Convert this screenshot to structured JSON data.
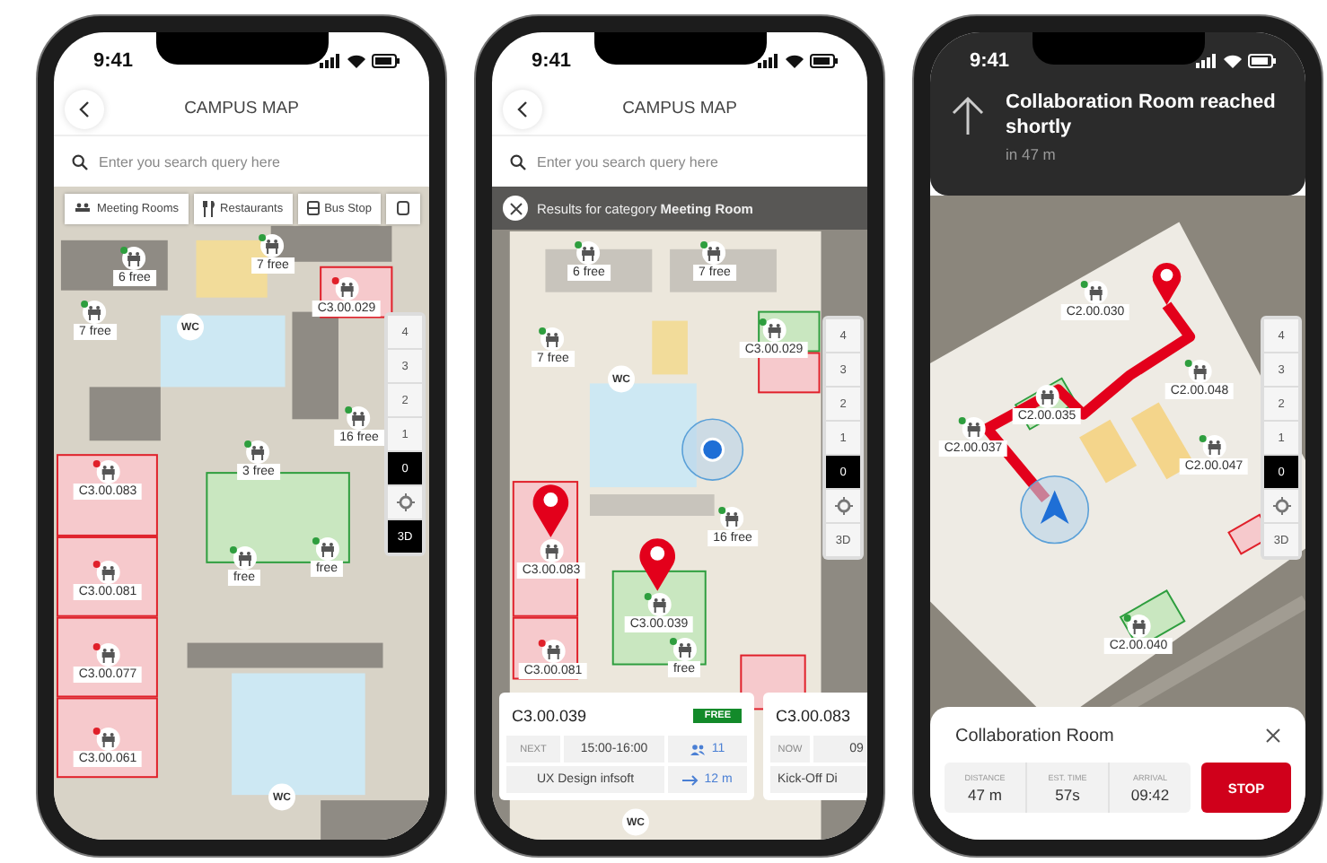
{
  "phones": [
    {
      "kind": "search",
      "status_time": "9:41",
      "title": "CAMPUS MAP",
      "search": {
        "placeholder": "Enter you search query here"
      },
      "chips": [
        {
          "label": "Meeting Rooms"
        },
        {
          "label": "Restaurants"
        },
        {
          "label": "Bus Stop"
        }
      ],
      "map_labels": [
        {
          "kind": "room",
          "text": "6 free",
          "color": "#2e9e3e"
        },
        {
          "kind": "room",
          "text": "7 free",
          "color": "#2e9e3e"
        },
        {
          "kind": "room",
          "text": "C3.00.029",
          "color": "#e0202a"
        },
        {
          "kind": "room",
          "text": "7 free",
          "color": "#2e9e3e"
        },
        {
          "kind": "room",
          "text": "16 free",
          "color": "#2e9e3e"
        },
        {
          "kind": "room",
          "text": "3 free",
          "color": "#2e9e3e"
        },
        {
          "kind": "room",
          "text": "C3.00.083",
          "color": "#e0202a"
        },
        {
          "kind": "room",
          "text": "C3.00.081",
          "color": "#e0202a"
        },
        {
          "kind": "room",
          "text": "free",
          "color": "#2e9e3e"
        },
        {
          "kind": "room",
          "text": "free",
          "color": "#2e9e3e"
        },
        {
          "kind": "room",
          "text": "C3.00.077",
          "color": "#e0202a"
        },
        {
          "kind": "room",
          "text": "C3.00.061",
          "color": "#e0202a"
        },
        {
          "kind": "wc",
          "text": "WC"
        },
        {
          "kind": "wc",
          "text": "WC"
        }
      ],
      "floors": [
        {
          "label": "4",
          "selected": false
        },
        {
          "label": "3",
          "selected": false
        },
        {
          "label": "2",
          "selected": false
        },
        {
          "label": "1",
          "selected": false
        },
        {
          "label": "0",
          "selected": true
        }
      ],
      "view_toggle": {
        "label": "3D",
        "selected": true
      }
    },
    {
      "kind": "results",
      "status_time": "9:41",
      "title": "CAMPUS MAP",
      "search": {
        "placeholder": "Enter you search query here"
      },
      "results_bar": "Results for category **Meeting Room**",
      "map_labels": [
        {
          "kind": "room",
          "text": "6 free",
          "color": "#2e9e3e"
        },
        {
          "kind": "room",
          "text": "7 free",
          "color": "#2e9e3e"
        },
        {
          "kind": "room",
          "text": "7 free",
          "color": "#2e9e3e"
        },
        {
          "kind": "room",
          "text": "C3.00.029",
          "color": "#2e9e3e"
        },
        {
          "kind": "room",
          "text": "16 free",
          "color": "#2e9e3e"
        },
        {
          "kind": "room",
          "text": "C3.00.083"
        },
        {
          "kind": "room",
          "text": "C3.00.039",
          "color": "#2e9e3e"
        },
        {
          "kind": "room",
          "text": "C3.00.081",
          "color": "#e0202a"
        },
        {
          "kind": "room",
          "text": "free",
          "color": "#2e9e3e"
        },
        {
          "kind": "wc",
          "text": "WC"
        },
        {
          "kind": "wc",
          "text": "WC"
        }
      ],
      "floors": [
        {
          "label": "4",
          "selected": false
        },
        {
          "label": "3",
          "selected": false
        },
        {
          "label": "2",
          "selected": false
        },
        {
          "label": "1",
          "selected": false
        },
        {
          "label": "0",
          "selected": true
        }
      ],
      "view_toggle": {
        "label": "3D",
        "selected": false
      },
      "cards": [
        {
          "room": "C3.00.039",
          "badge": "FREE",
          "slot_label": "NEXT",
          "slot": "15:00-16:00",
          "capacity": "11",
          "event": "UX Design infsoft",
          "distance": "12 m"
        },
        {
          "room": "C3.00.083",
          "slot_label": "NOW",
          "slot": "09",
          "event": "Kick-Off Di"
        }
      ]
    },
    {
      "kind": "navigation",
      "status_time": "9:41",
      "instruction": "Collaboration Room reached shortly",
      "instruction_distance": "in 47 m",
      "map_labels": [
        {
          "kind": "room",
          "text": "C2.00.030",
          "color": "#2e9e3e"
        },
        {
          "kind": "room",
          "text": "C2.00.035"
        },
        {
          "kind": "room",
          "text": "C2.00.048",
          "color": "#2e9e3e"
        },
        {
          "kind": "room",
          "text": "C2.00.037",
          "color": "#2e9e3e"
        },
        {
          "kind": "room",
          "text": "C2.00.047",
          "color": "#2e9e3e"
        },
        {
          "kind": "room",
          "text": "C2.00.040",
          "color": "#2e9e3e"
        }
      ],
      "floors": [
        {
          "label": "4",
          "selected": false
        },
        {
          "label": "3",
          "selected": false
        },
        {
          "label": "2",
          "selected": false
        },
        {
          "label": "1",
          "selected": false
        },
        {
          "label": "0",
          "selected": true
        }
      ],
      "view_toggle": {
        "label": "3D",
        "selected": false
      },
      "sheet": {
        "title": "Collaboration Room",
        "stats": [
          {
            "label": "DISTANCE",
            "value": "47 m"
          },
          {
            "label": "EST. TIME",
            "value": "57s"
          },
          {
            "label": "ARRIVAL",
            "value": "09:42"
          }
        ],
        "stop": "STOP"
      }
    }
  ]
}
